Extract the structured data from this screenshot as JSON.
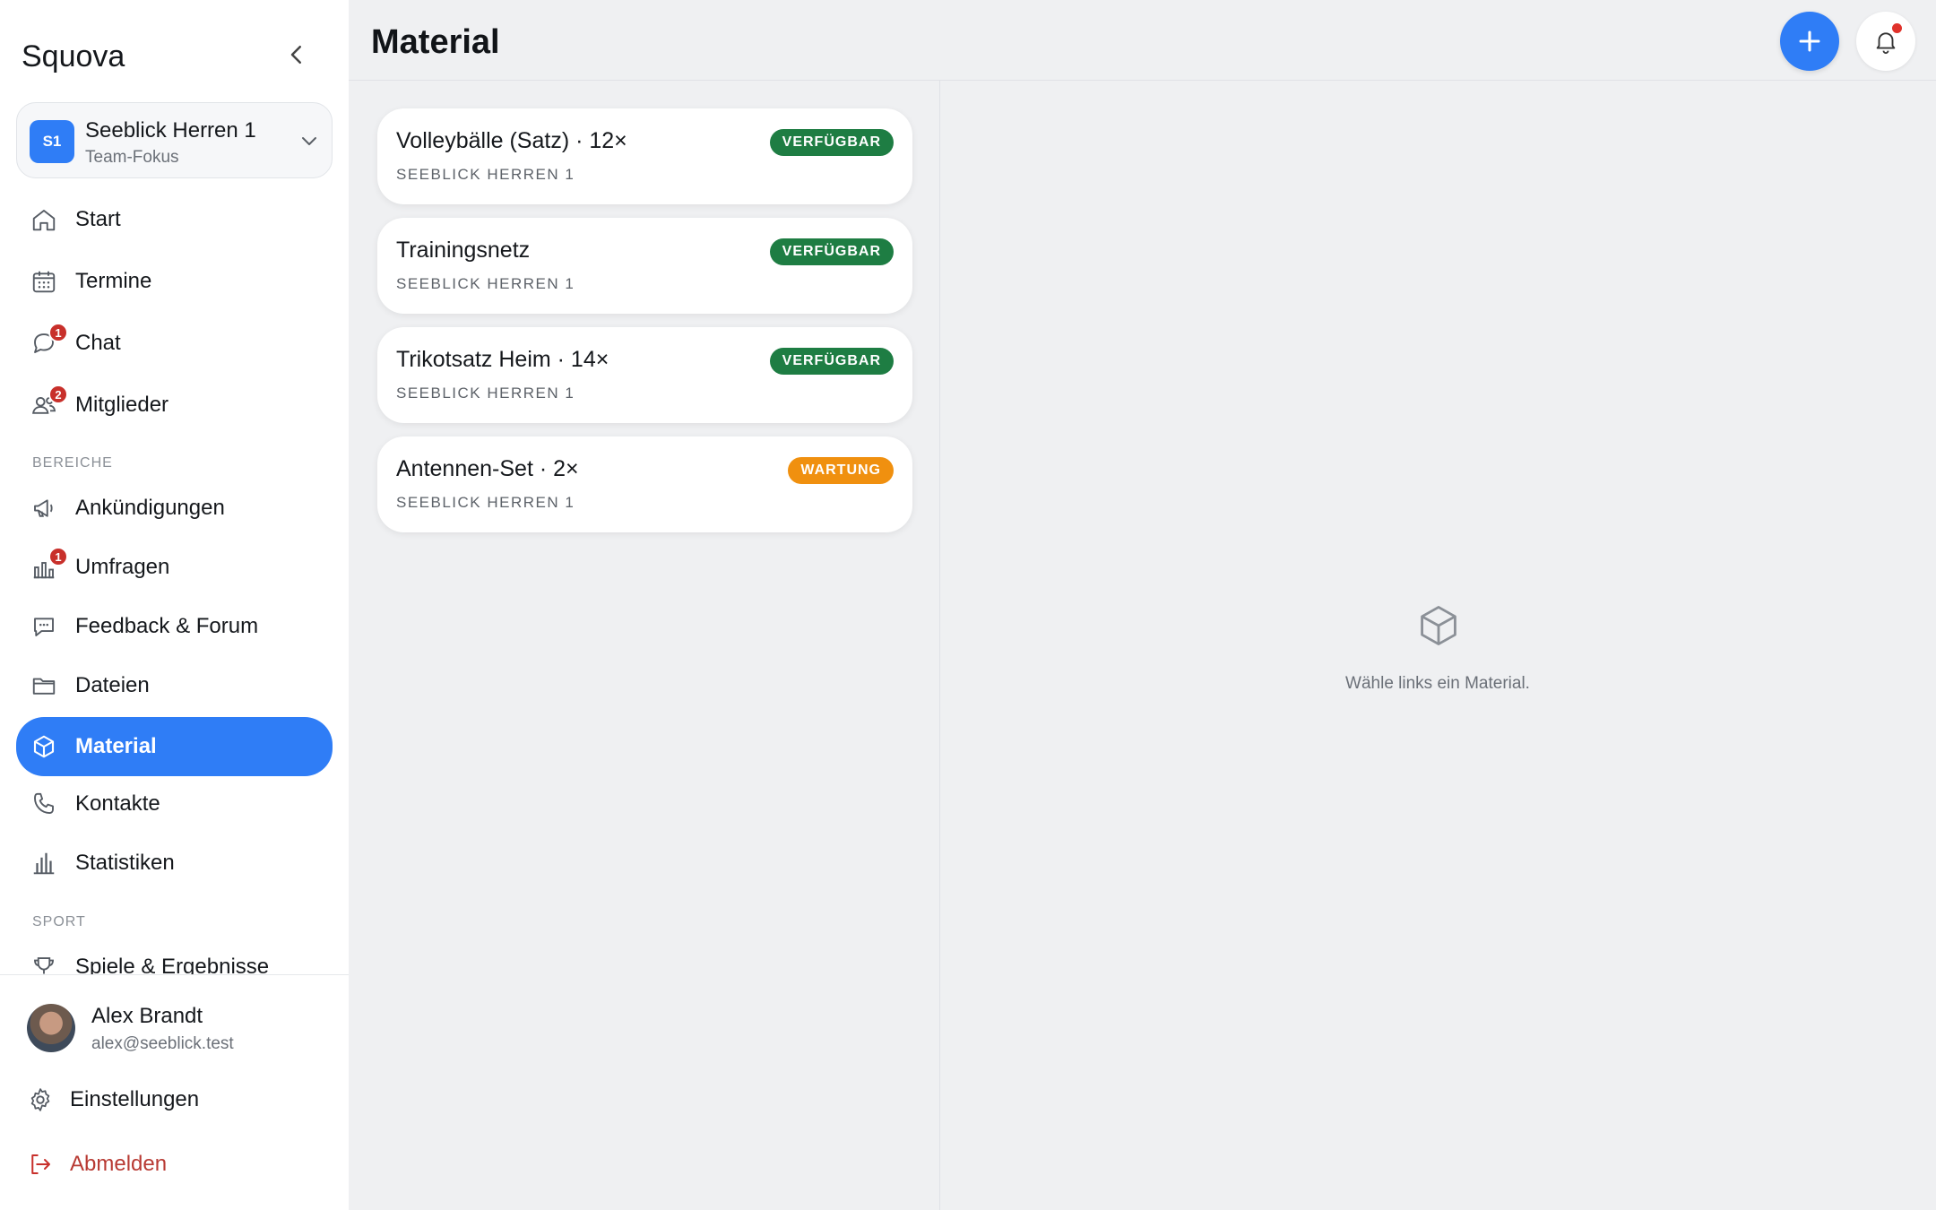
{
  "app": {
    "brand": "Squova"
  },
  "team": {
    "initials": "S1",
    "name": "Seeblick Herren 1",
    "subtitle": "Team-Fokus"
  },
  "nav": {
    "main": [
      {
        "label": "Start",
        "icon": "home-icon"
      },
      {
        "label": "Termine",
        "icon": "calendar-icon"
      },
      {
        "label": "Chat",
        "icon": "chat-icon",
        "badge": "1"
      },
      {
        "label": "Mitglieder",
        "icon": "users-icon",
        "badge": "2"
      }
    ],
    "section_bereiche": "BEREICHE",
    "bereiche": [
      {
        "label": "Ankündigungen",
        "icon": "megaphone-icon"
      },
      {
        "label": "Umfragen",
        "icon": "poll-icon",
        "badge": "1"
      },
      {
        "label": "Feedback & Forum",
        "icon": "message-dots-icon"
      },
      {
        "label": "Dateien",
        "icon": "folder-icon"
      },
      {
        "label": "Material",
        "icon": "box-icon",
        "active": true
      },
      {
        "label": "Kontakte",
        "icon": "phone-icon"
      },
      {
        "label": "Statistiken",
        "icon": "bar-chart-icon"
      }
    ],
    "section_sport": "SPORT",
    "sport": [
      {
        "label": "Spiele & Ergebnisse",
        "icon": "trophy-icon"
      }
    ]
  },
  "user": {
    "name": "Alex Brandt",
    "email": "alex@seeblick.test"
  },
  "footer": {
    "settings_label": "Einstellungen",
    "logout_label": "Abmelden"
  },
  "page": {
    "title": "Material"
  },
  "materials": [
    {
      "title": "Volleybälle (Satz) · 12×",
      "team": "SEEBLICK HERREN 1",
      "status": "VERFÜGBAR",
      "status_color": "#1e7d43"
    },
    {
      "title": "Trainingsnetz",
      "team": "SEEBLICK HERREN 1",
      "status": "VERFÜGBAR",
      "status_color": "#1e7d43"
    },
    {
      "title": "Trikotsatz Heim · 14×",
      "team": "SEEBLICK HERREN 1",
      "status": "VERFÜGBAR",
      "status_color": "#1e7d43"
    },
    {
      "title": "Antennen-Set · 2×",
      "team": "SEEBLICK HERREN 1",
      "status": "WARTUNG",
      "status_color": "#f0900f"
    }
  ],
  "empty_state": {
    "icon": "box-icon",
    "text": "Wähle links ein Material."
  },
  "colors": {
    "accent": "#2f7df6",
    "badge_red": "#c8302b",
    "available": "#1e7d43",
    "maintenance": "#f0900f"
  }
}
